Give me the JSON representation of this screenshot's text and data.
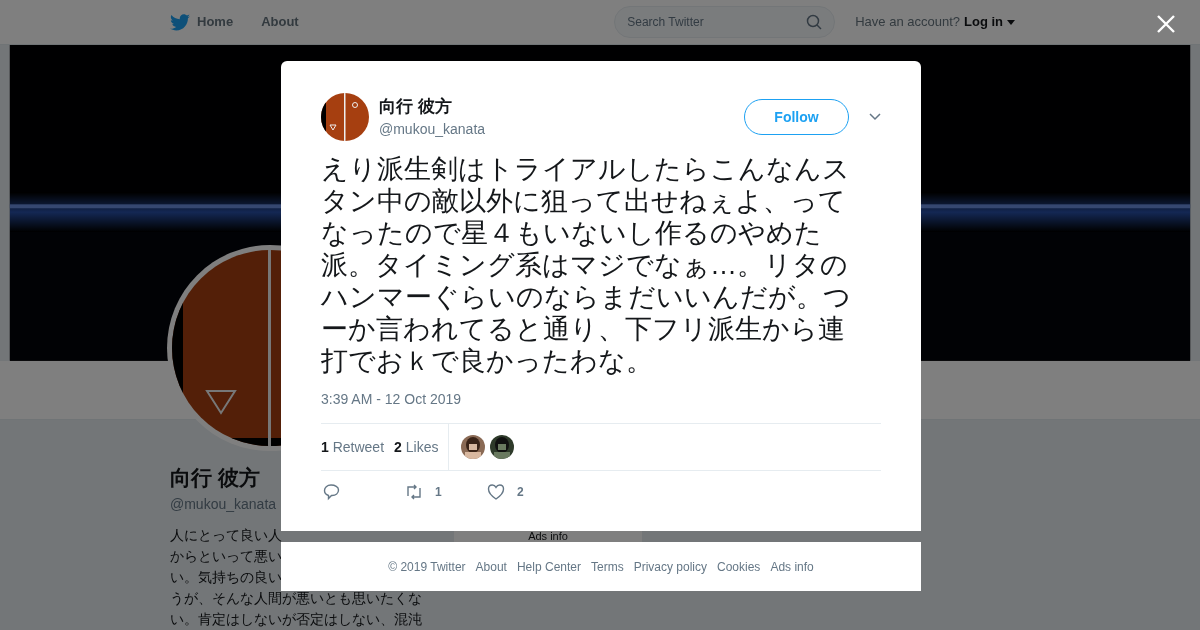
{
  "top_nav": {
    "items": [
      {
        "label": "Home",
        "kind": "home"
      },
      {
        "label": "About",
        "kind": "plain"
      }
    ],
    "search": {
      "placeholder": "Search Twitter"
    },
    "account_prompt": "Have an account?",
    "login": "Log in"
  },
  "profile": {
    "name": "向行 彼方",
    "handle": "@mukou_kanata",
    "bio_lines": [
      "人にとって良い人",
      "からといって悪い",
      "い。気持ちの良い",
      "うが、そんな人間が悪いとも思いたくな",
      "い。肯定はしないが否定はしない、混沌"
    ]
  },
  "background_card": {
    "link": "Ads info"
  },
  "tweet": {
    "name": "向行 彼方",
    "handle": "@mukou_kanata",
    "follow": "Follow",
    "text": "えり派生剣はトライアルしたらこんなんスタン中の敵以外に狙って出せねぇよ、ってなったので星４もいないし作るのやめた派。タイミング系はマジでなぁ…。リタのハンマーぐらいのならまだいいんだが。つーか言われてると通り、下フリ派生から連打でおｋで良かったわな。",
    "time": "3:39 AM - 12 Oct 2019",
    "stats": [
      {
        "count": "1",
        "label": "Retweet"
      },
      {
        "count": "2",
        "label": "Likes"
      }
    ],
    "actions": [
      {
        "kind": "reply"
      },
      {
        "kind": "retweet",
        "count": "1"
      },
      {
        "kind": "like",
        "count": "2"
      }
    ]
  },
  "footer": {
    "links": [
      "© 2019 Twitter",
      "About",
      "Help Center",
      "Terms",
      "Privacy policy",
      "Cookies",
      "Ads info"
    ]
  }
}
